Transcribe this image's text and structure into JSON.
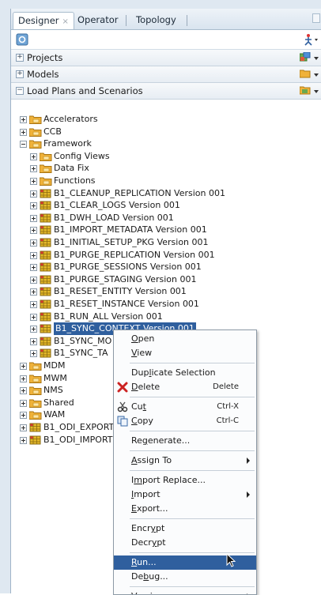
{
  "tabs": [
    {
      "label": "Designer",
      "close": "×",
      "active": true
    },
    {
      "label": "Operator",
      "active": false
    },
    {
      "label": "Topology",
      "active": false
    }
  ],
  "accordions": [
    {
      "label": "Projects",
      "toggle": "+",
      "icon": "new-project-icon"
    },
    {
      "label": "Models",
      "toggle": "+",
      "icon": "folder-icon"
    },
    {
      "label": "Load Plans and Scenarios",
      "toggle": "−",
      "icon": "load-plan-icon"
    }
  ],
  "tree": [
    {
      "label": "Accelerators",
      "type": "folder",
      "depth": 0
    },
    {
      "label": "CCB",
      "type": "folder",
      "depth": 0
    },
    {
      "label": "Framework",
      "type": "folder",
      "depth": 0,
      "expanded": true
    },
    {
      "label": "Config Views",
      "type": "folder",
      "depth": 1
    },
    {
      "label": "Data Fix",
      "type": "folder",
      "depth": 1
    },
    {
      "label": "Functions",
      "type": "folder",
      "depth": 1
    },
    {
      "label": "B1_CLEANUP_REPLICATION Version 001",
      "type": "scenario",
      "depth": 1
    },
    {
      "label": "B1_CLEAR_LOGS Version 001",
      "type": "scenario",
      "depth": 1
    },
    {
      "label": "B1_DWH_LOAD Version 001",
      "type": "scenario",
      "depth": 1
    },
    {
      "label": "B1_IMPORT_METADATA Version 001",
      "type": "scenario",
      "depth": 1
    },
    {
      "label": "B1_INITIAL_SETUP_PKG Version 001",
      "type": "scenario",
      "depth": 1
    },
    {
      "label": "B1_PURGE_REPLICATION Version 001",
      "type": "scenario",
      "depth": 1
    },
    {
      "label": "B1_PURGE_SESSIONS Version 001",
      "type": "scenario",
      "depth": 1
    },
    {
      "label": "B1_PURGE_STAGING Version 001",
      "type": "scenario",
      "depth": 1
    },
    {
      "label": "B1_RESET_ENTITY Version 001",
      "type": "scenario",
      "depth": 1
    },
    {
      "label": "B1_RESET_INSTANCE Version 001",
      "type": "scenario",
      "depth": 1
    },
    {
      "label": "B1_RUN_ALL Version 001",
      "type": "scenario",
      "depth": 1
    },
    {
      "label": "B1_SYNC_CONTEXT Version 001",
      "type": "scenario",
      "depth": 1,
      "selected": true
    },
    {
      "label": "B1_SYNC_MO",
      "type": "scenario",
      "depth": 1
    },
    {
      "label": "B1_SYNC_TA",
      "type": "scenario",
      "depth": 1
    },
    {
      "label": "MDM",
      "type": "folder",
      "depth": 0
    },
    {
      "label": "MWM",
      "type": "folder",
      "depth": 0
    },
    {
      "label": "NMS",
      "type": "folder",
      "depth": 0
    },
    {
      "label": "Shared",
      "type": "folder",
      "depth": 0
    },
    {
      "label": "WAM",
      "type": "folder",
      "depth": 0
    },
    {
      "label": "B1_ODI_EXPORT",
      "type": "scenario",
      "depth": 0
    },
    {
      "label": "B1_ODI_IMPORT",
      "type": "scenario",
      "depth": 0
    }
  ],
  "context_menu": [
    {
      "label": "Open",
      "mnemonic_index": 0
    },
    {
      "label": "View",
      "mnemonic_index": 0
    },
    {
      "separator": true
    },
    {
      "label": "Duplicate Selection",
      "mnemonic_index": 3
    },
    {
      "label": "Delete",
      "shortcut": "Delete",
      "icon": "delete-icon",
      "mnemonic_index": 0
    },
    {
      "separator": true
    },
    {
      "label": "Cut",
      "shortcut": "Ctrl-X",
      "icon": "cut-icon",
      "mnemonic_index": 2
    },
    {
      "label": "Copy",
      "shortcut": "Ctrl-C",
      "icon": "copy-icon",
      "mnemonic_index": 0
    },
    {
      "separator": true
    },
    {
      "label": "Regenerate...",
      "mnemonic_index": 2
    },
    {
      "separator": true
    },
    {
      "label": "Assign To",
      "submenu": true,
      "mnemonic_index": 0
    },
    {
      "separator": true
    },
    {
      "label": "Import Replace...",
      "mnemonic_index": 1
    },
    {
      "label": "Import",
      "submenu": true,
      "mnemonic_index": 0
    },
    {
      "label": "Export...",
      "mnemonic_index": 0
    },
    {
      "separator": true
    },
    {
      "label": "Encrypt",
      "mnemonic_index": 4
    },
    {
      "label": "Decrypt",
      "mnemonic_index": 4
    },
    {
      "separator": true
    },
    {
      "label": "Run...",
      "mnemonic_index": 0,
      "highlighted": true
    },
    {
      "label": "Debug...",
      "mnemonic_index": 2
    },
    {
      "separator": true
    },
    {
      "label": "Version",
      "submenu": true,
      "mnemonic_index": 0
    }
  ],
  "colors": {
    "selection": "#2f5f9e",
    "folder": "#f0b23a",
    "scenario": "#e3b82a",
    "delete_icon": "#cc2222"
  }
}
